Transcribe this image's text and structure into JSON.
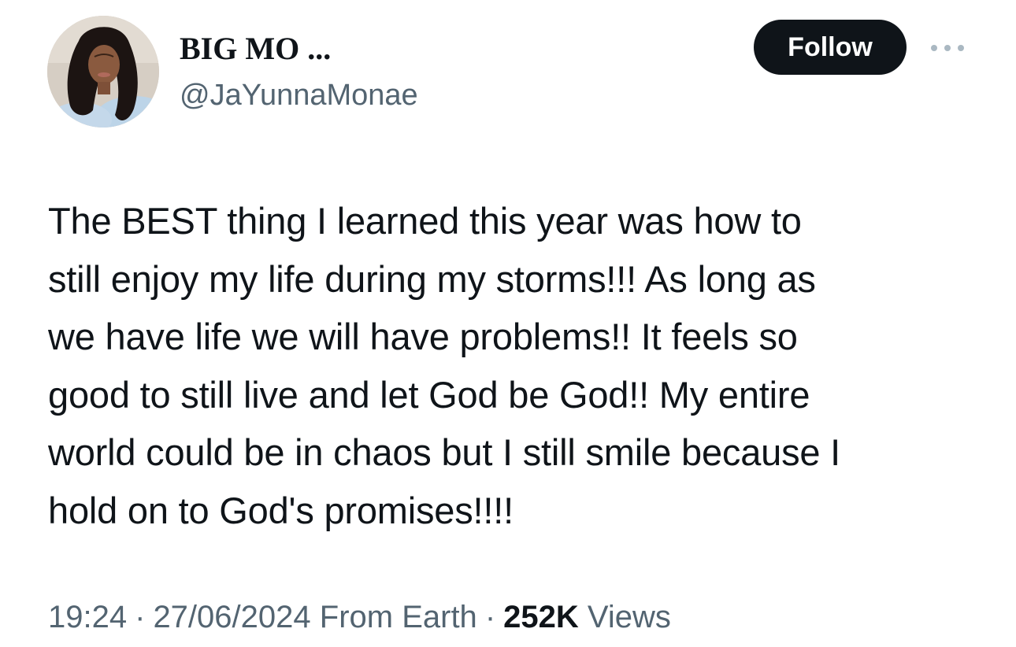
{
  "author": {
    "display_name": "BIG MO ...",
    "handle": "@JaYunnaMonae"
  },
  "actions": {
    "follow_label": "Follow",
    "more_icon": "more-horizontal-icon"
  },
  "tweet": {
    "text": "The BEST thing I learned this year was how to\nstill enjoy my life during my storms!!! As long as\nwe have life we will have problems!! It feels so\ngood to still live and let God be God!! My entire\nworld could be in chaos but I still smile because I\nhold on to God's promises!!!!",
    "time": "19:24",
    "date": "27/06/2024",
    "source": "From Earth",
    "separator": "·",
    "views_count": "252K",
    "views_label": "Views"
  },
  "colors": {
    "text_primary": "#0f1419",
    "text_secondary": "#536471",
    "follow_bg": "#0f1419",
    "follow_text": "#ffffff",
    "more_icon": "#aab8c2"
  }
}
